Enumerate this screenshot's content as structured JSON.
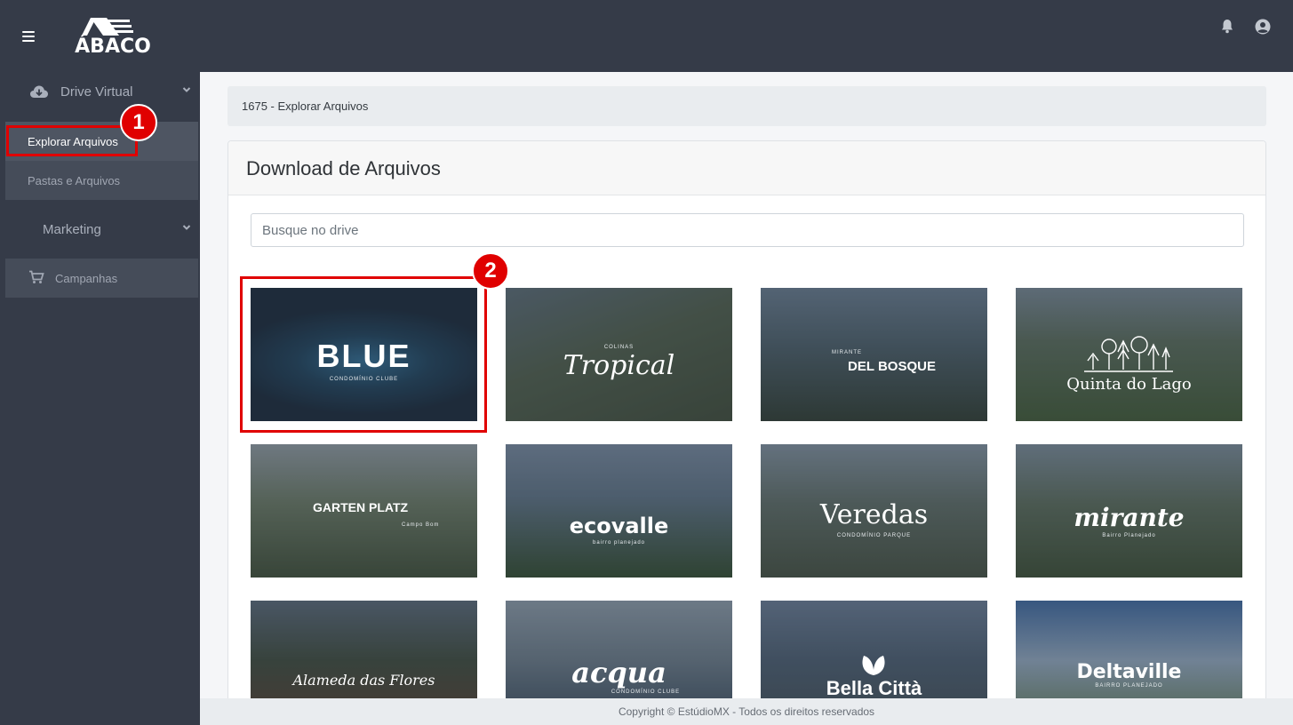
{
  "header": {
    "logo_text": "ÁBACO",
    "menu_icon": "hamburger-icon",
    "notification_icon": "bell-icon",
    "user_icon": "user-circle-icon"
  },
  "sidebar": {
    "groups": [
      {
        "label": "Drive Virtual",
        "icon": "cloud-download-icon"
      },
      {
        "label": "Marketing"
      }
    ],
    "items": [
      {
        "label": "Explorar Arquivos"
      },
      {
        "label": "Pastas e Arquivos"
      },
      {
        "label": "Campanhas",
        "icon": "cart-icon"
      }
    ]
  },
  "annotations": [
    "1",
    "2"
  ],
  "breadcrumb": "1675 - Explorar Arquivos",
  "main": {
    "title": "Download de Arquivos",
    "search_placeholder": "Busque no drive"
  },
  "projects": [
    {
      "label": "BLUE",
      "sub": "CONDOMÍNIO CLUBE"
    },
    {
      "label": "Tropical",
      "sub": "COLINAS"
    },
    {
      "label": "DEL BOSQUE",
      "sub": "MIRANTE"
    },
    {
      "label": "Quinta do Lago",
      "sub": ""
    },
    {
      "label": "GARTEN PLATZ",
      "sub": "Campo Bom"
    },
    {
      "label": "ecovalle",
      "sub": "bairro planejado"
    },
    {
      "label": "Veredas",
      "sub": "CONDOMÍNIO PARQUE"
    },
    {
      "label": "mirante",
      "sub": "Bairro Planejado"
    },
    {
      "label": "Alameda das Flores",
      "sub": ""
    },
    {
      "label": "acqua",
      "sub": "CONDOMÍNIO CLUBE"
    },
    {
      "label": "Bella Città",
      "sub": ""
    },
    {
      "label": "Deltaville",
      "sub": "BAIRRO PLANEJADO"
    }
  ],
  "footer": "Copyright © EstúdioMX - Todos os direitos reservados",
  "colors": {
    "sidebar_bg": "#353b48",
    "annotation_red": "#e00000"
  }
}
